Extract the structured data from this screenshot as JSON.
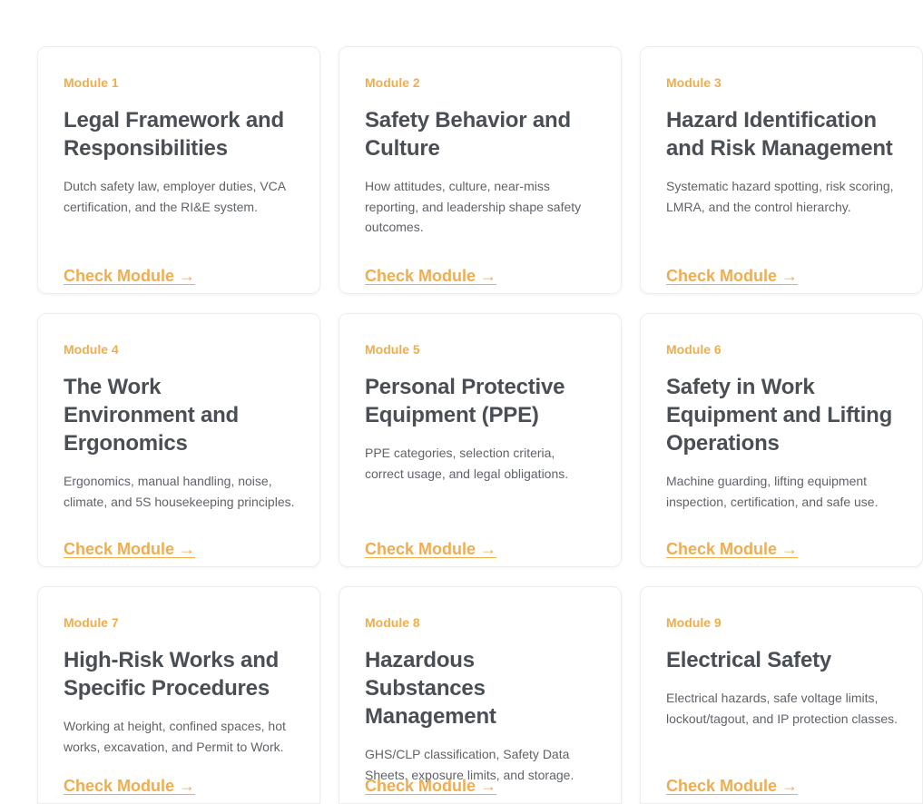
{
  "modules": [
    {
      "tag": "Module 1",
      "title": "Legal Framework and Responsibilities",
      "description": "Dutch safety law, employer duties, VCA certification, and the RI&E system.",
      "link": "Check Module →"
    },
    {
      "tag": "Module 2",
      "title": "Safety Behavior and Culture",
      "description": "How attitudes, culture, near-miss reporting, and leadership shape safety outcomes.",
      "link": "Check Module →"
    },
    {
      "tag": "Module 3",
      "title": "Hazard Identification and Risk Management",
      "description": "Systematic hazard spotting, risk scoring, LMRA, and the control hierarchy.",
      "link": "Check Module →"
    },
    {
      "tag": "Module 4",
      "title": "The Work Environment and Ergonomics",
      "description": "Ergonomics, manual handling, noise, climate, and 5S housekeeping principles.",
      "link": "Check Module →"
    },
    {
      "tag": "Module 5",
      "title": "Personal Protective Equipment (PPE)",
      "description": "PPE categories, selection criteria, correct usage, and legal obligations.",
      "link": "Check Module →"
    },
    {
      "tag": "Module 6",
      "title": "Safety in Work Equipment and Lifting Operations",
      "description": "Machine guarding, lifting equipment inspection, certification, and safe use.",
      "link": "Check Module →"
    },
    {
      "tag": "Module 7",
      "title": "High-Risk Works and Specific Procedures",
      "description": "Working at height, confined spaces, hot works, excavation, and Permit to Work.",
      "link": "Check Module →"
    },
    {
      "tag": "Module 8",
      "title": "Hazardous Substances Management",
      "description": "GHS/CLP classification, Safety Data Sheets, exposure limits, and storage.",
      "link": "Check Module →"
    },
    {
      "tag": "Module 9",
      "title": "Electrical Safety",
      "description": "Electrical hazards, safe voltage limits, lockout/tagout, and IP protection classes.",
      "link": "Check Module →"
    }
  ],
  "colors": {
    "accent": "#f0ad4e",
    "title": "#4a4f55",
    "text": "#5f6368"
  }
}
